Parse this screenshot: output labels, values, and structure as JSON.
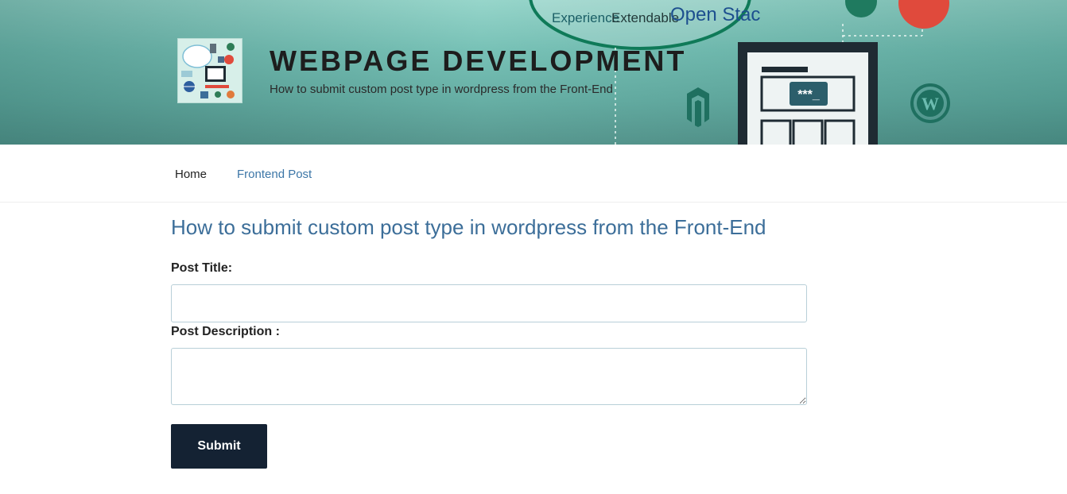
{
  "header": {
    "site_title": "WEBPAGE DEVELOPMENT",
    "tagline": "How to submit custom post type in wordpress from the Front-End",
    "banner_words": [
      "Experience",
      "Extendable",
      "Open Stac",
      "***_"
    ]
  },
  "nav": {
    "items": [
      {
        "label": "Home"
      },
      {
        "label": "Frontend Post"
      }
    ]
  },
  "main": {
    "heading": "How to submit custom post type in wordpress from the Front-End",
    "post_title_label": "Post Title:",
    "post_title_value": "",
    "post_description_label": "Post Description :",
    "post_description_value": "",
    "submit_label": "Submit"
  },
  "colors": {
    "accent_link": "#3c76a7",
    "heading": "#3c6e99",
    "button_bg": "#142233",
    "header_teal": "#6cbcb0"
  }
}
